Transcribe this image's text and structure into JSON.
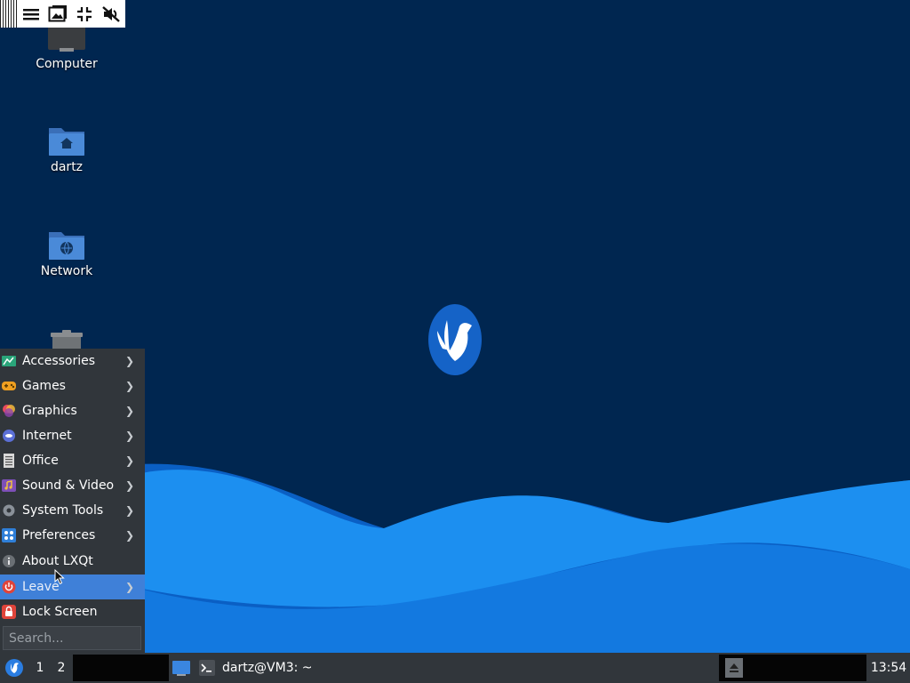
{
  "toolbar": {
    "buttons": [
      "menu-icon",
      "image-icon",
      "fullscreen-exit-icon",
      "mute-icon"
    ]
  },
  "desktop_icons": {
    "computer": "Computer",
    "home": "dartz",
    "network": "Network"
  },
  "menu": {
    "items": [
      {
        "label": "Accessories",
        "icon": "accessories-icon",
        "submenu": true
      },
      {
        "label": "Games",
        "icon": "games-icon",
        "submenu": true
      },
      {
        "label": "Graphics",
        "icon": "graphics-icon",
        "submenu": true
      },
      {
        "label": "Internet",
        "icon": "internet-icon",
        "submenu": true
      },
      {
        "label": "Office",
        "icon": "office-icon",
        "submenu": true
      },
      {
        "label": "Sound & Video",
        "icon": "sound-video-icon",
        "submenu": true
      },
      {
        "label": "System Tools",
        "icon": "system-tools-icon",
        "submenu": true
      },
      {
        "label": "Preferences",
        "icon": "preferences-icon",
        "submenu": true
      },
      {
        "label": "About LXQt",
        "icon": "about-icon",
        "submenu": false
      },
      {
        "label": "Leave",
        "icon": "power-icon",
        "submenu": true,
        "highlighted": true
      },
      {
        "label": "Lock Screen",
        "icon": "lock-icon",
        "submenu": false
      }
    ],
    "search_placeholder": "Search..."
  },
  "taskbar": {
    "workspaces": [
      "1",
      "2"
    ],
    "task_title": "dartz@VM3: ~",
    "clock": "13:54"
  },
  "colors": {
    "desktop_bg": "#002650",
    "wave_light": "#1c8ff0",
    "wave_dark": "#0f6fd6",
    "panel_bg": "#31363b",
    "highlight": "#3f80d8"
  }
}
